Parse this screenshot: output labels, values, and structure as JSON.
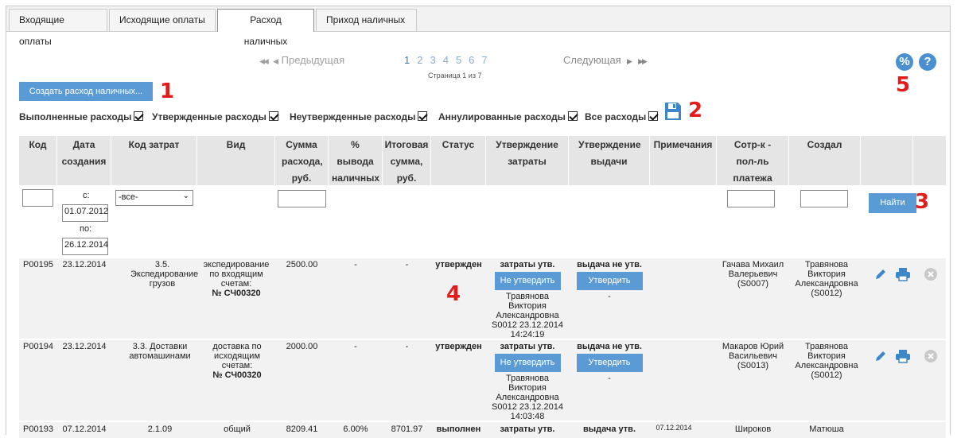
{
  "tabs": [
    {
      "label": "Входящие оплаты"
    },
    {
      "label": "Исходящие оплаты"
    },
    {
      "label": "Расход наличных"
    },
    {
      "label": "Приход наличных"
    }
  ],
  "pagination": {
    "first_glyph": "◀◀",
    "prev_label": "Предыдущая",
    "next_label": "Следующая",
    "last_glyph": "▶▶",
    "pages": [
      "1",
      "2",
      "3",
      "4",
      "5",
      "6",
      "7"
    ],
    "current_page": "1",
    "info": "Страница 1 из 7"
  },
  "create_button_label": "Создать расход наличных...",
  "annotations": [
    "1",
    "2",
    "3",
    "4",
    "5"
  ],
  "filters": {
    "completed": "Выполненные расходы",
    "approved": "Утвержденные расходы",
    "unapproved": "Неутвержденные расходы",
    "cancelled": "Аннулированные расходы",
    "all": "Все расходы"
  },
  "icons": {
    "percent": "%",
    "help": "?"
  },
  "table_headers": {
    "code": "Код",
    "created_date": "Дата создания",
    "cost_code": "Код затрат",
    "kind": "Вид",
    "amount": "Сумма расхода, руб.",
    "percent": "% вывода наличных",
    "total": "Итоговая сумма, руб.",
    "status": "Статус",
    "cost_approval": "Утверждение затраты",
    "payout_approval": "Утверждение выдачи",
    "notes": "Примечания",
    "payee": "Сотр-к - пол-ль платежа",
    "creator": "Создал"
  },
  "search": {
    "from_label": "с:",
    "from_value": "01.07.2012",
    "to_label": "по:",
    "to_value": "26.12.2014",
    "cost_code_select": "-все-",
    "find_button": "Найти"
  },
  "rows": [
    {
      "code": "P00195",
      "date": "23.12.2014",
      "cost_code": "3.5. Экспедирование грузов",
      "kind": "экспедирование по входящим счетам:",
      "kind_ref": "№ СЧ00320",
      "amount": "2500.00",
      "percent": "-",
      "total": "-",
      "status": "утвержден",
      "cost_status": "затраты утв.",
      "cost_button": "Не утвердить",
      "cost_approver": "Травянова Виктория Александровна S0012 23.12.2014 14:24:19",
      "payout_status": "выдача не утв.",
      "payout_button": "Утвердить",
      "payout_dash": "-",
      "payee": "Гачава Михаил Валерьевич (S0007)",
      "creator": "Травянова Виктория Александровна (S0012)"
    },
    {
      "code": "P00194",
      "date": "23.12.2014",
      "cost_code": "3.3. Доставки автомашинами",
      "kind": "доставка по исходящим счетам:",
      "kind_ref": "№ СЧ00320",
      "amount": "2000.00",
      "percent": "-",
      "total": "-",
      "status": "утвержден",
      "cost_status": "затраты утв.",
      "cost_button": "Не утвердить",
      "cost_approver": "Травянова Виктория Александровна S0012 23.12.2014 14:03:48",
      "payout_status": "выдача не утв.",
      "payout_button": "Утвердить",
      "payout_dash": "-",
      "payee": "Макаров Юрий Васильевич (S0013)",
      "creator": "Травянова Виктория Александровна (S0012)"
    },
    {
      "code": "P00193",
      "date": "07.12.2014",
      "cost_code": "2.1.09",
      "kind": "общий",
      "amount": "8209.41",
      "percent": "6.00%",
      "total": "8701.97",
      "status": "выполнен",
      "cost_status": "затраты утв.",
      "payout_status": "выдача утв.",
      "note": "07.12.2014",
      "payee": "Широков",
      "creator": "Матюша"
    }
  ]
}
